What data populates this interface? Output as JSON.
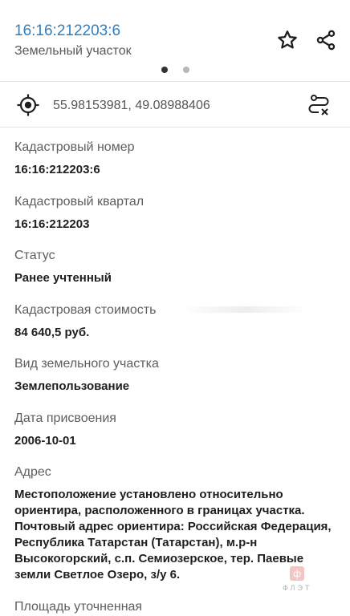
{
  "header": {
    "title": "16:16:212203:6",
    "subtitle": "Земельный участок",
    "pager": {
      "count": 2,
      "active_index": 0
    }
  },
  "location": {
    "coordinates": "55.98153981, 49.08988406"
  },
  "fields": [
    {
      "label": "Кадастровый номер",
      "value": "16:16:212203:6"
    },
    {
      "label": "Кадастровый квартал",
      "value": "16:16:212203"
    },
    {
      "label": "Статус",
      "value": "Ранее учтенный"
    },
    {
      "label": "Кадастровая стоимость",
      "value": "84 640,5 руб."
    },
    {
      "label": "Вид земельного участка",
      "value": "Землепользование"
    },
    {
      "label": "Дата присвоения",
      "value": "2006-10-01"
    }
  ],
  "address": {
    "label": "Адрес",
    "lines": [
      "Местоположение установлено относительно",
      "ориентира, расположенного в границах участка.",
      "Почтовый адрес ориентира: Российская Федерация,",
      "Республика Татарстан (Татарстан), м.р-н",
      "Высокогорский, с.п. Семиозерское, тер. Паевые",
      "земли Светлое Озеро, з/у 6."
    ]
  },
  "next_field": {
    "label": "Площадь уточненная"
  },
  "watermark": {
    "glyph": "ф",
    "text": "ФЛЭТ"
  },
  "icons": {
    "favorite": "star-outline-icon",
    "share": "share-icon",
    "locate": "crosshair-icon",
    "route": "route-icon"
  }
}
